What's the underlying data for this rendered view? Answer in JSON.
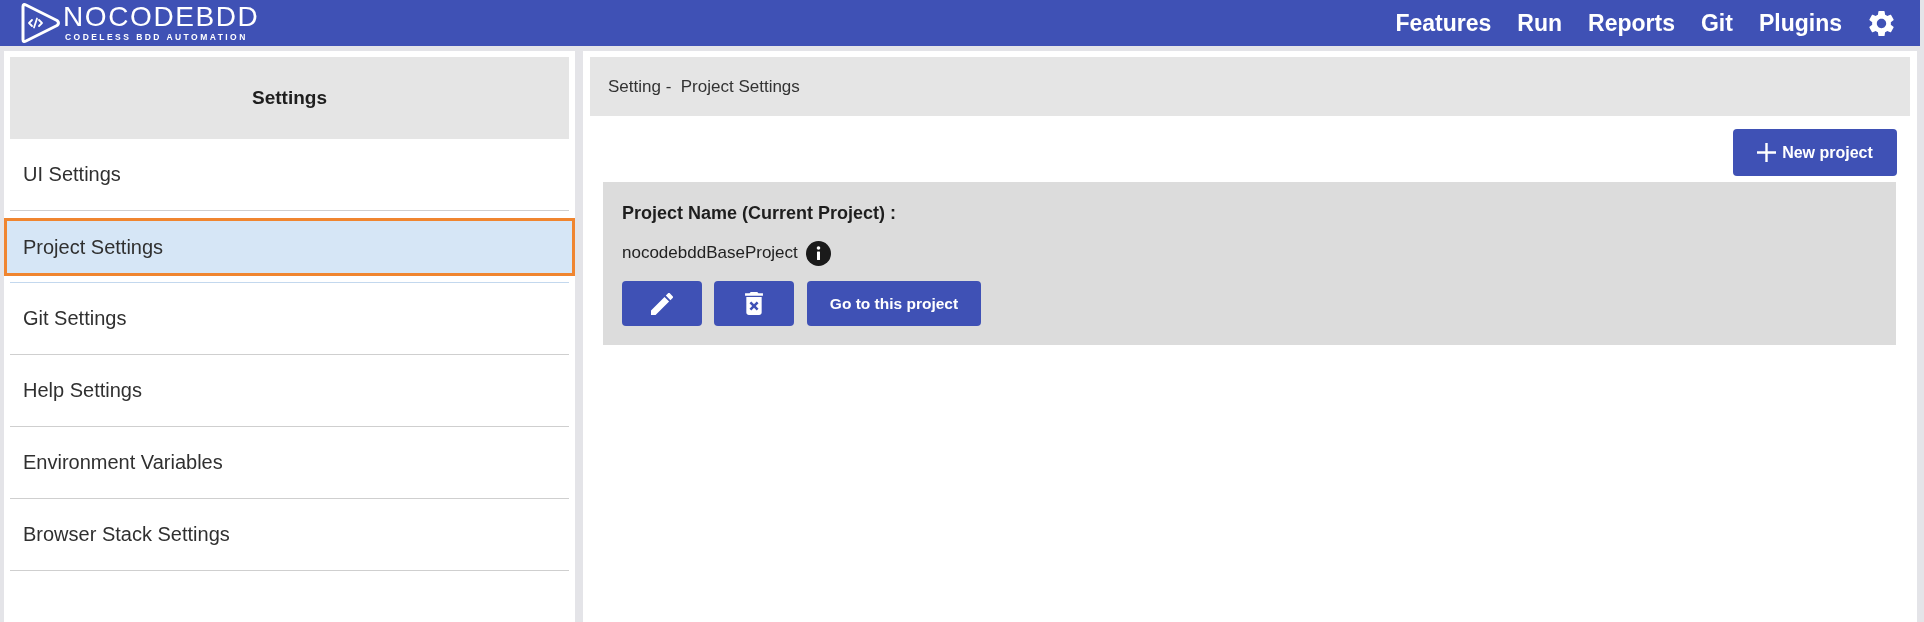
{
  "header": {
    "logo": {
      "title": "NOCODEBDD",
      "tagline": "CODELESS BDD AUTOMATION"
    },
    "nav": [
      "Features",
      "Run",
      "Reports",
      "Git",
      "Plugins"
    ]
  },
  "sidebar": {
    "title": "Settings",
    "items": [
      {
        "label": "UI Settings",
        "selected": false
      },
      {
        "label": "Project Settings",
        "selected": true
      },
      {
        "label": "Git Settings",
        "selected": false
      },
      {
        "label": "Help Settings",
        "selected": false
      },
      {
        "label": "Environment Variables",
        "selected": false
      },
      {
        "label": "Browser Stack Settings",
        "selected": false
      }
    ]
  },
  "main": {
    "breadcrumb": "Setting -  Project Settings",
    "new_project_button": "New project",
    "project_card": {
      "heading": "Project Name (Current Project) :",
      "name": "nocodebddBaseProject",
      "go_button": "Go to this project"
    }
  }
}
